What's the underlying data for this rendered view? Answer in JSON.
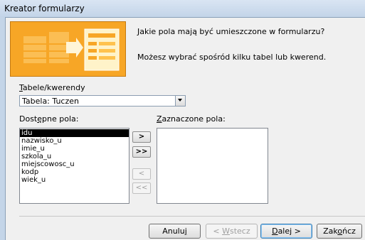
{
  "window": {
    "title": "Kreator formularzy"
  },
  "prompt": {
    "question": "Jakie pola mają być umieszczone w formularzu?",
    "hint": "Możesz wybrać spośród kilku tabel lub kwerend."
  },
  "tables": {
    "label": "Tabele/kwerendy",
    "label_accesskey": "T",
    "label_rest": "abele/kwerendy",
    "selected": "Tabela: Tuczen"
  },
  "available": {
    "label_pre": "Dost",
    "label_key": "ę",
    "label_post": "pne pola:",
    "items": [
      "idu",
      "nazwisko_u",
      "imie_u",
      "szkola_u",
      "miejscowosc_u",
      "kodp",
      "wiek_u"
    ],
    "selected_index": 0
  },
  "selected_fields": {
    "label_key": "Z",
    "label_rest": "aznaczone pola:",
    "items": []
  },
  "move_buttons": {
    "add_one": ">",
    "add_all": ">>",
    "remove_one": "<",
    "remove_all": "<<"
  },
  "footer": {
    "cancel_pre": "Anulu",
    "cancel_key": "j",
    "back_pre": "< ",
    "back_key": "W",
    "back_post": "stecz",
    "next_pre": "",
    "next_key": "D",
    "next_post": "alej >",
    "finish_pre": "Zak",
    "finish_key": "o",
    "finish_post": "ńcz"
  }
}
